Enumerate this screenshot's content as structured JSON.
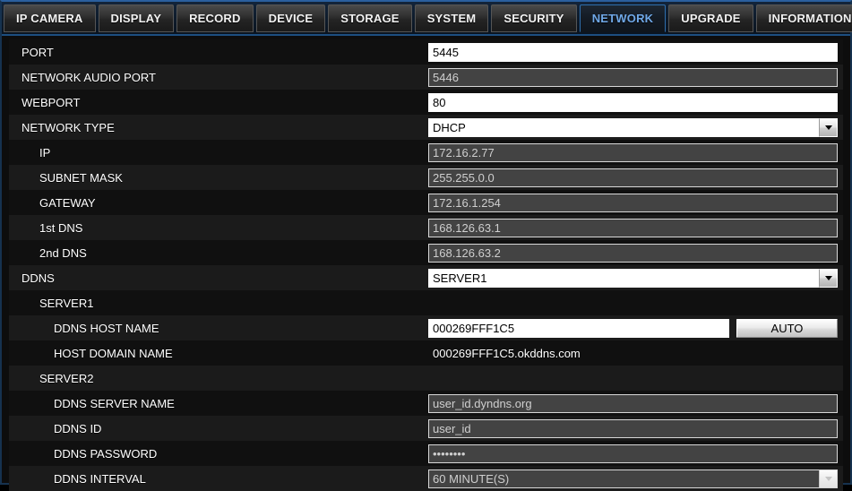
{
  "tabs": [
    {
      "label": "IP CAMERA",
      "active": false
    },
    {
      "label": "DISPLAY",
      "active": false
    },
    {
      "label": "RECORD",
      "active": false
    },
    {
      "label": "DEVICE",
      "active": false
    },
    {
      "label": "STORAGE",
      "active": false
    },
    {
      "label": "SYSTEM",
      "active": false
    },
    {
      "label": "SECURITY",
      "active": false
    },
    {
      "label": "NETWORK",
      "active": true
    },
    {
      "label": "UPGRADE",
      "active": false
    },
    {
      "label": "INFORMATION",
      "active": false
    }
  ],
  "colors": {
    "accent_blue": "#2f6fae",
    "active_tab_text": "#6fa8e8",
    "row_dark": "#101010",
    "row_light": "#1b1b1b",
    "field_enabled_bg": "#ffffff",
    "field_disabled_bg": "#434343",
    "field_disabled_text": "#cfcfcf"
  },
  "rows": [
    {
      "label": "PORT",
      "indent": 0,
      "type": "input",
      "value": "5445",
      "enabled": true
    },
    {
      "label": "NETWORK AUDIO PORT",
      "indent": 0,
      "type": "input",
      "value": "5446",
      "enabled": false
    },
    {
      "label": "WEBPORT",
      "indent": 0,
      "type": "input",
      "value": "80",
      "enabled": true
    },
    {
      "label": "NETWORK TYPE",
      "indent": 0,
      "type": "select",
      "value": "DHCP",
      "enabled": true
    },
    {
      "label": "IP",
      "indent": 1,
      "type": "input",
      "value": "172.16.2.77",
      "enabled": false
    },
    {
      "label": "SUBNET MASK",
      "indent": 1,
      "type": "input",
      "value": "255.255.0.0",
      "enabled": false
    },
    {
      "label": "GATEWAY",
      "indent": 1,
      "type": "input",
      "value": "172.16.1.254",
      "enabled": false
    },
    {
      "label": "1st DNS",
      "indent": 1,
      "type": "input",
      "value": "168.126.63.1",
      "enabled": false
    },
    {
      "label": "2nd DNS",
      "indent": 1,
      "type": "input",
      "value": "168.126.63.2",
      "enabled": false
    },
    {
      "label": "DDNS",
      "indent": 0,
      "type": "select",
      "value": "SERVER1",
      "enabled": true
    },
    {
      "label": "SERVER1",
      "indent": 1,
      "type": "header",
      "value": "",
      "enabled": false
    },
    {
      "label": "DDNS HOST NAME",
      "indent": 2,
      "type": "input-button",
      "value": "000269FFF1C5",
      "enabled": true,
      "button": "AUTO"
    },
    {
      "label": "HOST DOMAIN NAME",
      "indent": 2,
      "type": "static",
      "value": "000269FFF1C5.okddns.com",
      "enabled": false
    },
    {
      "label": "SERVER2",
      "indent": 1,
      "type": "header",
      "value": "",
      "enabled": false
    },
    {
      "label": "DDNS SERVER NAME",
      "indent": 2,
      "type": "input",
      "value": "user_id.dyndns.org",
      "enabled": false
    },
    {
      "label": "DDNS ID",
      "indent": 2,
      "type": "input",
      "value": "user_id",
      "enabled": false
    },
    {
      "label": "DDNS PASSWORD",
      "indent": 2,
      "type": "input",
      "value": "••••••••",
      "enabled": false
    },
    {
      "label": "DDNS INTERVAL",
      "indent": 2,
      "type": "select",
      "value": "60 MINUTE(S)",
      "enabled": false
    }
  ]
}
